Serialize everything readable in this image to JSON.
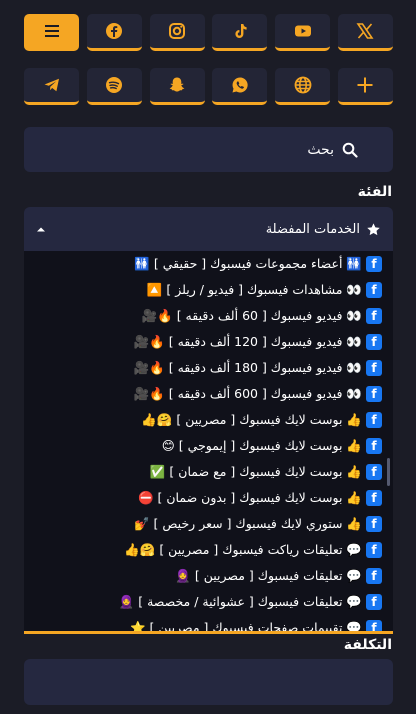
{
  "social_buttons": [
    {
      "name": "menu-icon"
    },
    {
      "name": "facebook-icon"
    },
    {
      "name": "instagram-icon"
    },
    {
      "name": "tiktok-icon"
    },
    {
      "name": "youtube-icon"
    },
    {
      "name": "x-twitter-icon"
    },
    {
      "name": "telegram-icon"
    },
    {
      "name": "spotify-icon"
    },
    {
      "name": "snapchat-icon"
    },
    {
      "name": "whatsapp-icon"
    },
    {
      "name": "globe-icon"
    },
    {
      "name": "plus-icon"
    }
  ],
  "colors": {
    "accent": "#f5a623",
    "background": "#1b1c26",
    "panel": "#252840",
    "list_bg": "#10111a",
    "facebook": "#1877f2"
  },
  "search": {
    "placeholder": "بحث"
  },
  "category": {
    "label": "الفئة",
    "selected": "الخدمات المفضلة",
    "selected_icon": "star-icon"
  },
  "services": [
    "🚻 أعضاء مجموعات فيسبوك [ حقيقي ] 🚻",
    "👀 مشاهدات فيسبوك [ فيديو / ريلز ] 🔼",
    "👀 فيديو فيسبوك [ 60 ألف دقيقه ] 🔥🎥",
    "👀 فيديو فيسبوك [ 120 ألف دقيقه ] 🔥🎥",
    "👀 فيديو فيسبوك [ 180 ألف دقيقه ] 🔥🎥",
    "👀 فيديو فيسبوك [ 600 ألف دقيقه ] 🔥🎥",
    "👍 بوست لايك فيسبوك [ مصريين ] 🤗👍",
    "👍 بوست لايك فيسبوك [ إيموجي ] 😊",
    "👍 بوست لايك فيسبوك [ مع ضمان ] ✅",
    "👍 بوست لايك فيسبوك [ بدون ضمان ] ⛔",
    "👍 ستوري لايك فيسبوك [ سعر رخيص ] 💅",
    "💬 تعليقات رياكت فيسبوك [ مصريين ] 🤗👍",
    "💬 تعليقات فيسبوك [ مصريين ] 🧕",
    "💬 تعليقات فيسبوك [ عشوائية / مخصصة ] 🧕",
    "💬 تقييمات صفحات فيسبوك [ مصريين ] ⭐"
  ],
  "cost": {
    "label": "التكلفة"
  }
}
